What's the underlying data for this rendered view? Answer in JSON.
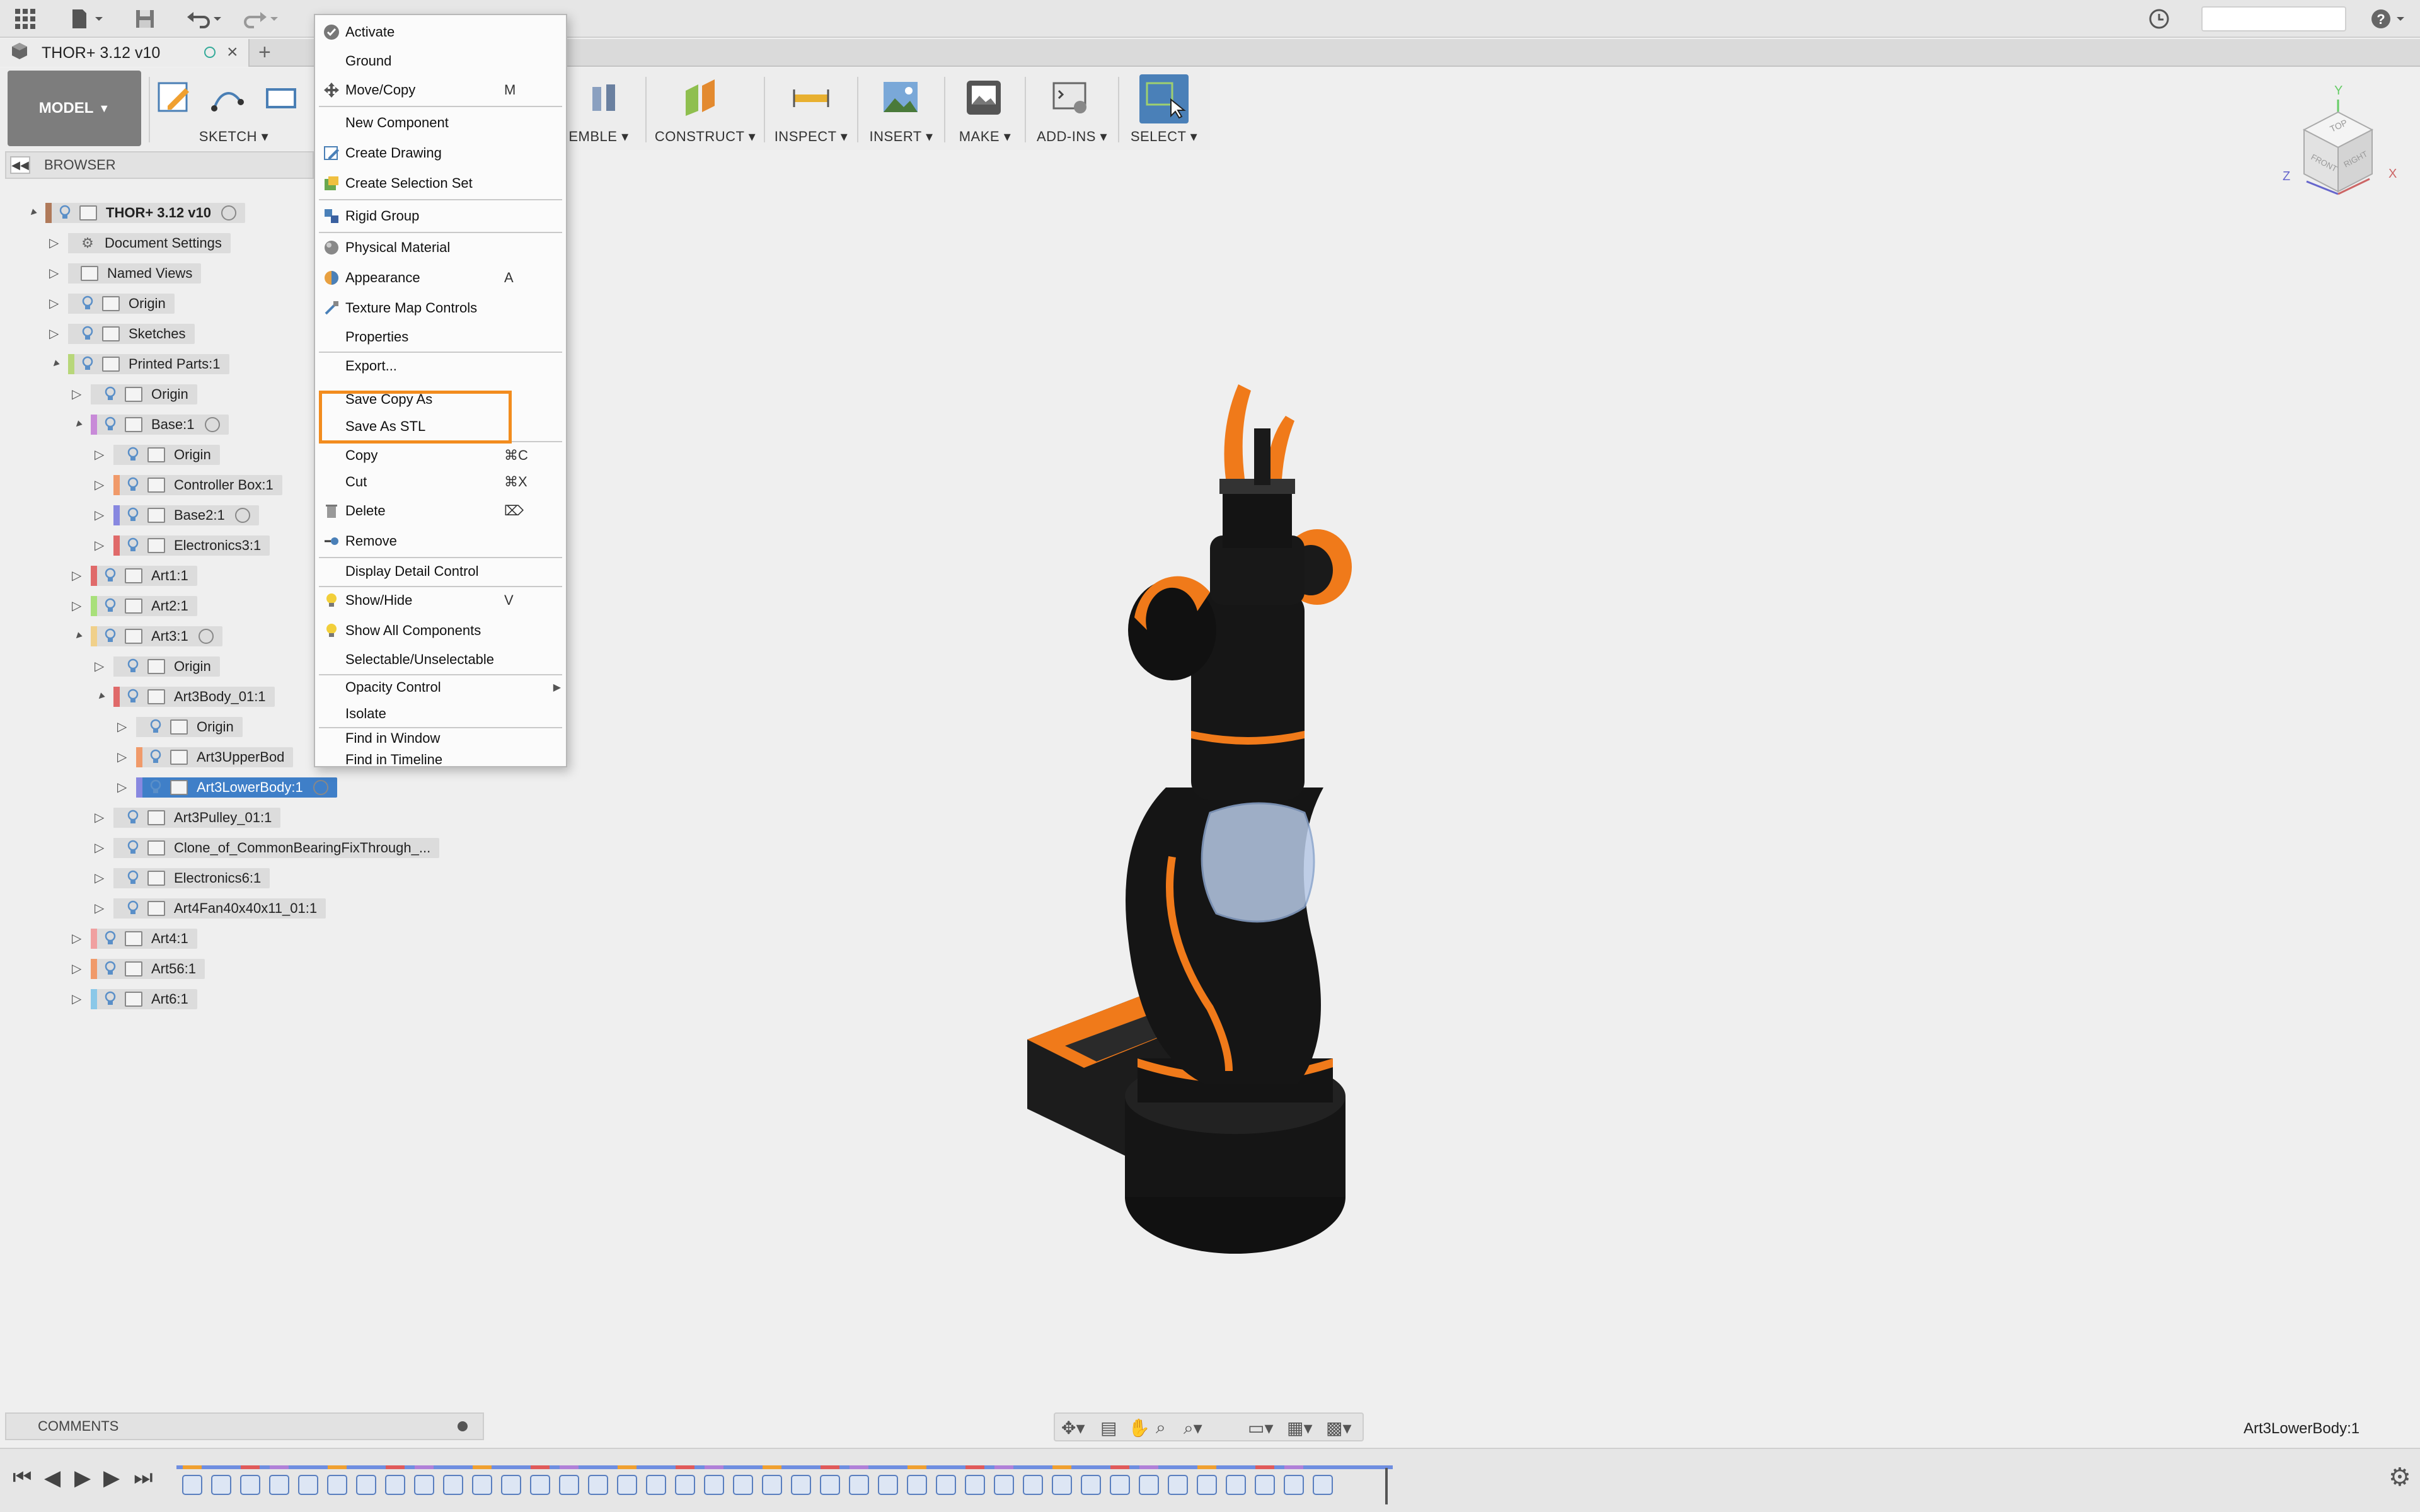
{
  "document": {
    "title": "THOR+ 3.12 v10"
  },
  "toolbar": {
    "mode": "MODEL",
    "groups": [
      "SKETCH",
      "EMBLE",
      "CONSTRUCT",
      "INSPECT",
      "INSERT",
      "MAKE",
      "ADD-INS",
      "SELECT"
    ]
  },
  "browser": {
    "title": "BROWSER",
    "tree": [
      {
        "label": "THOR+ 3.12 v10",
        "stripe": "#b07a5a"
      },
      {
        "label": "Document Settings",
        "stripe": "#dcdcdc"
      },
      {
        "label": "Named Views",
        "stripe": "#dcdcdc"
      },
      {
        "label": "Origin",
        "stripe": "#dcdcdc"
      },
      {
        "label": "Sketches",
        "stripe": "#dcdcdc"
      },
      {
        "label": "Printed Parts:1",
        "stripe": "#b8d77a"
      },
      {
        "label": "Origin",
        "stripe": "#dcdcdc"
      },
      {
        "label": "Base:1",
        "stripe": "#c88ad8"
      },
      {
        "label": "Origin",
        "stripe": "#dcdcdc"
      },
      {
        "label": "Controller Box:1",
        "stripe": "#f09a6a"
      },
      {
        "label": "Base2:1",
        "stripe": "#8888e0"
      },
      {
        "label": "Electronics3:1",
        "stripe": "#e06a6a"
      },
      {
        "label": "Art1:1",
        "stripe": "#e06a6a"
      },
      {
        "label": "Art2:1",
        "stripe": "#a8e07a"
      },
      {
        "label": "Art3:1",
        "stripe": "#f0d08a"
      },
      {
        "label": "Origin",
        "stripe": "#dcdcdc"
      },
      {
        "label": "Art3Body_01:1",
        "stripe": "#e06a6a"
      },
      {
        "label": "Origin",
        "stripe": "#dcdcdc"
      },
      {
        "label": "Art3UpperBod",
        "stripe": "#f09a6a"
      },
      {
        "label": "Art3LowerBody:1",
        "stripe": "#8888e0"
      },
      {
        "label": "Art3Pulley_01:1",
        "stripe": "#dcdcdc"
      },
      {
        "label": "Clone_of_CommonBearingFixThrough_...",
        "stripe": "#dcdcdc"
      },
      {
        "label": "Electronics6:1",
        "stripe": "#dcdcdc"
      },
      {
        "label": "Art4Fan40x40x11_01:1",
        "stripe": "#dcdcdc"
      },
      {
        "label": "Art4:1",
        "stripe": "#f0a0a0"
      },
      {
        "label": "Art56:1",
        "stripe": "#f09a6a"
      },
      {
        "label": "Art6:1",
        "stripe": "#8ac8e8"
      }
    ]
  },
  "context_menu": {
    "items": [
      {
        "label": "Activate",
        "shortcut": ""
      },
      {
        "label": "Ground",
        "shortcut": ""
      },
      {
        "label": "Move/Copy",
        "shortcut": "M"
      },
      {
        "label": "New Component",
        "shortcut": ""
      },
      {
        "label": "Create Drawing",
        "shortcut": ""
      },
      {
        "label": "Create Selection Set",
        "shortcut": ""
      },
      {
        "label": "Rigid Group",
        "shortcut": ""
      },
      {
        "label": "Physical Material",
        "shortcut": ""
      },
      {
        "label": "Appearance",
        "shortcut": "A"
      },
      {
        "label": "Texture Map Controls",
        "shortcut": ""
      },
      {
        "label": "Properties",
        "shortcut": ""
      },
      {
        "label": "Export...",
        "shortcut": ""
      },
      {
        "label": "Save Copy As",
        "shortcut": ""
      },
      {
        "label": "Save As STL",
        "shortcut": ""
      },
      {
        "label": "Copy",
        "shortcut": "⌘C"
      },
      {
        "label": "Cut",
        "shortcut": "⌘X"
      },
      {
        "label": "Delete",
        "shortcut": "⌦"
      },
      {
        "label": "Remove",
        "shortcut": ""
      },
      {
        "label": "Display Detail Control",
        "shortcut": ""
      },
      {
        "label": "Show/Hide",
        "shortcut": "V"
      },
      {
        "label": "Show All Components",
        "shortcut": ""
      },
      {
        "label": "Selectable/Unselectable",
        "shortcut": ""
      },
      {
        "label": "Opacity Control",
        "shortcut": ""
      },
      {
        "label": "Isolate",
        "shortcut": ""
      },
      {
        "label": "Find in Window",
        "shortcut": ""
      },
      {
        "label": "Find in Timeline",
        "shortcut": ""
      }
    ]
  },
  "comments": {
    "title": "COMMENTS"
  },
  "status": {
    "selection": "Art3LowerBody:1"
  },
  "colors": {
    "accent": "#f28c1e",
    "selection": "#3f7fc8",
    "robot_orange": "#f07a1a"
  }
}
